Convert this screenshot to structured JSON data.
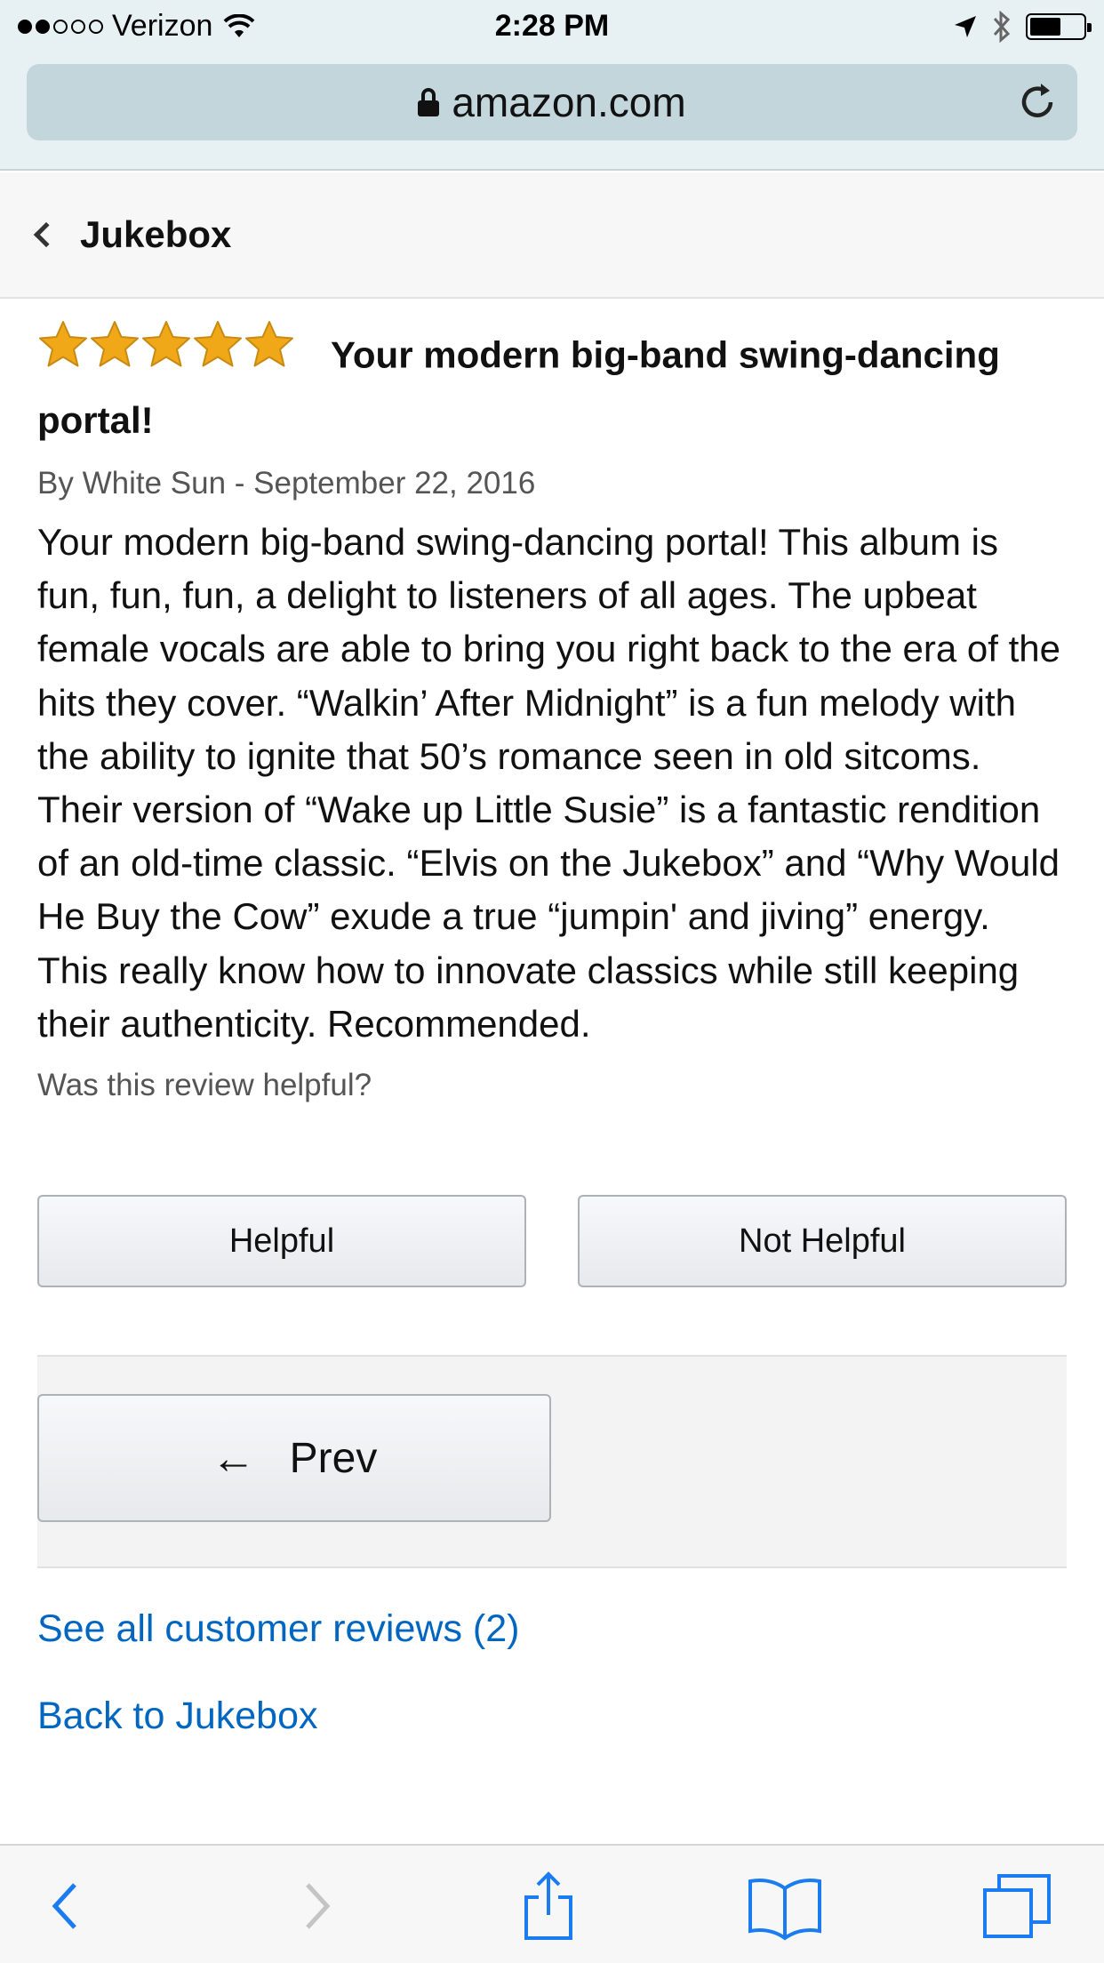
{
  "status_bar": {
    "carrier": "Verizon",
    "time": "2:28 PM",
    "signal_bars_filled": 2,
    "signal_bars_total": 5,
    "battery_level": 0.5
  },
  "browser": {
    "url": "amazon.com"
  },
  "nav": {
    "title": "Jukebox"
  },
  "review": {
    "rating": 5,
    "rating_max": 5,
    "star_color": "#f0a818",
    "title": "Your modern big-band swing-dancing portal!",
    "byline": "By White Sun - September 22, 2016",
    "body": "Your modern big-band swing-dancing portal! This album is fun, fun, fun, a delight to listeners of all ages. The upbeat female vocals are able to bring you right back to the era of the hits they cover. “Walkin’ After Midnight” is a fun melody with the ability to ignite that 50’s romance seen in old sitcoms. Their version of “Wake up Little Susie” is a fantastic rendition of an old-time classic. “Elvis on the Jukebox” and “Why Would He Buy the Cow” exude a true “jumpin' and jiving” energy. This really know how to innovate classics while still keeping their authenticity. Recommended.",
    "helpful_question": "Was this review helpful?",
    "helpful_label": "Helpful",
    "not_helpful_label": "Not Helpful"
  },
  "pager": {
    "prev_arrow": "←",
    "prev_label": "Prev"
  },
  "links": {
    "see_all": "See all customer reviews (2)",
    "back": "Back to Jukebox",
    "color": "#0066c0"
  },
  "toolbar": {
    "icons": [
      "back-icon",
      "forward-icon",
      "share-icon",
      "bookmarks-icon",
      "tabs-icon"
    ],
    "active_color": "#1a7cf0",
    "disabled_color": "#c4c4c4"
  }
}
